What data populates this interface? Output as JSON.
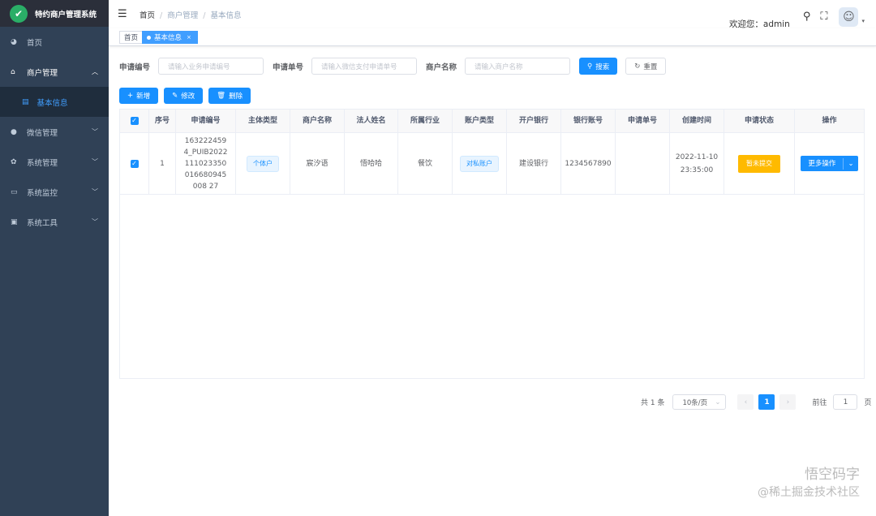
{
  "app_title": "特约商户管理系统",
  "sidebar": {
    "items": [
      {
        "label": "首页",
        "icon": "dashboard-icon"
      },
      {
        "label": "商户管理",
        "icon": "shop-icon",
        "expanded": true,
        "children": [
          {
            "label": "基本信息"
          }
        ]
      },
      {
        "label": "微信管理",
        "icon": "wechat-icon"
      },
      {
        "label": "系统管理",
        "icon": "gear-icon"
      },
      {
        "label": "系统监控",
        "icon": "monitor-icon"
      },
      {
        "label": "系统工具",
        "icon": "toolbox-icon"
      }
    ]
  },
  "header": {
    "breadcrumb": [
      "首页",
      "商户管理",
      "基本信息"
    ],
    "welcome": "欢迎您：admin"
  },
  "tags": [
    {
      "label": "首页"
    },
    {
      "label": "基本信息",
      "close": "×"
    }
  ],
  "search": {
    "apply_no_label": "申请编号",
    "apply_no_placeholder": "请输入业务申请编号",
    "order_no_label": "申请单号",
    "order_no_placeholder": "请输入微信支付申请单号",
    "merchant_label": "商户名称",
    "merchant_placeholder": "请输入商户名称",
    "search_btn": "搜索",
    "reset_btn": "重置"
  },
  "toolbar": {
    "add": "新增",
    "edit": "修改",
    "delete": "删除"
  },
  "table": {
    "columns": [
      "序号",
      "申请编号",
      "主体类型",
      "商户名称",
      "法人姓名",
      "所属行业",
      "账户类型",
      "开户银行",
      "银行账号",
      "申请单号",
      "创建时间",
      "申请状态",
      "操作"
    ],
    "rows": [
      {
        "index": "1",
        "apply_no": "1632224594_PUIB2022111023350016680945008 27",
        "subject_type": "个体户",
        "merchant": "宸汐语",
        "legal": "悟哈哈",
        "industry": "餐饮",
        "account_type": "对私账户",
        "bank": "建设银行",
        "bank_account": "1234567890",
        "order_no": "",
        "created_date": "2022-11-10",
        "created_time": "23:35:00",
        "status": "暂未提交",
        "action": "更多操作",
        "checked": true
      }
    ]
  },
  "pagination": {
    "total": "共 1 条",
    "page_size": "10条/页",
    "current": "1",
    "goto_label": "前往",
    "goto_value": "1",
    "page_unit": "页"
  },
  "watermark": {
    "line1": "悟空码字",
    "line2": "@稀土掘金技术社区"
  }
}
